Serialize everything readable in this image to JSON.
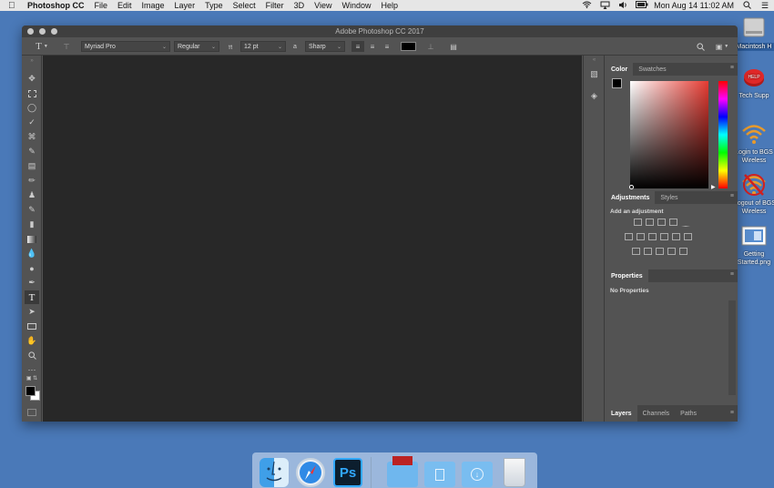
{
  "menubar": {
    "app_name": "Photoshop CC",
    "items": [
      "File",
      "Edit",
      "Image",
      "Layer",
      "Type",
      "Select",
      "Filter",
      "3D",
      "View",
      "Window",
      "Help"
    ],
    "status_icons": [
      "wifi-icon",
      "airplay-icon",
      "volume-icon",
      "battery-icon"
    ],
    "clock": "Mon Aug 14  11:02 AM"
  },
  "desktop": {
    "icons": [
      {
        "label": "Macintosh H"
      },
      {
        "label": "Tech Supp"
      },
      {
        "label1": "Login to BGS",
        "label2": "Wireless"
      },
      {
        "label1": "Logout of BGS",
        "label2": "Wireless"
      },
      {
        "label1": "Getting",
        "label2": "Started.png"
      }
    ]
  },
  "window": {
    "title": "Adobe Photoshop CC 2017"
  },
  "options": {
    "font_family": "Myriad Pro",
    "font_style": "Regular",
    "font_size": "12 pt",
    "antialias": "Sharp",
    "text_color": "#000000"
  },
  "panels": {
    "color_tab": "Color",
    "swatches_tab": "Swatches",
    "adjustments_tab": "Adjustments",
    "styles_tab": "Styles",
    "add_adjustment": "Add an adjustment",
    "properties_tab": "Properties",
    "no_properties": "No Properties",
    "layers_tab": "Layers",
    "channels_tab": "Channels",
    "paths_tab": "Paths"
  },
  "colors": {
    "accent": "#e63b32",
    "desktop_bg": "#4a79b8"
  }
}
